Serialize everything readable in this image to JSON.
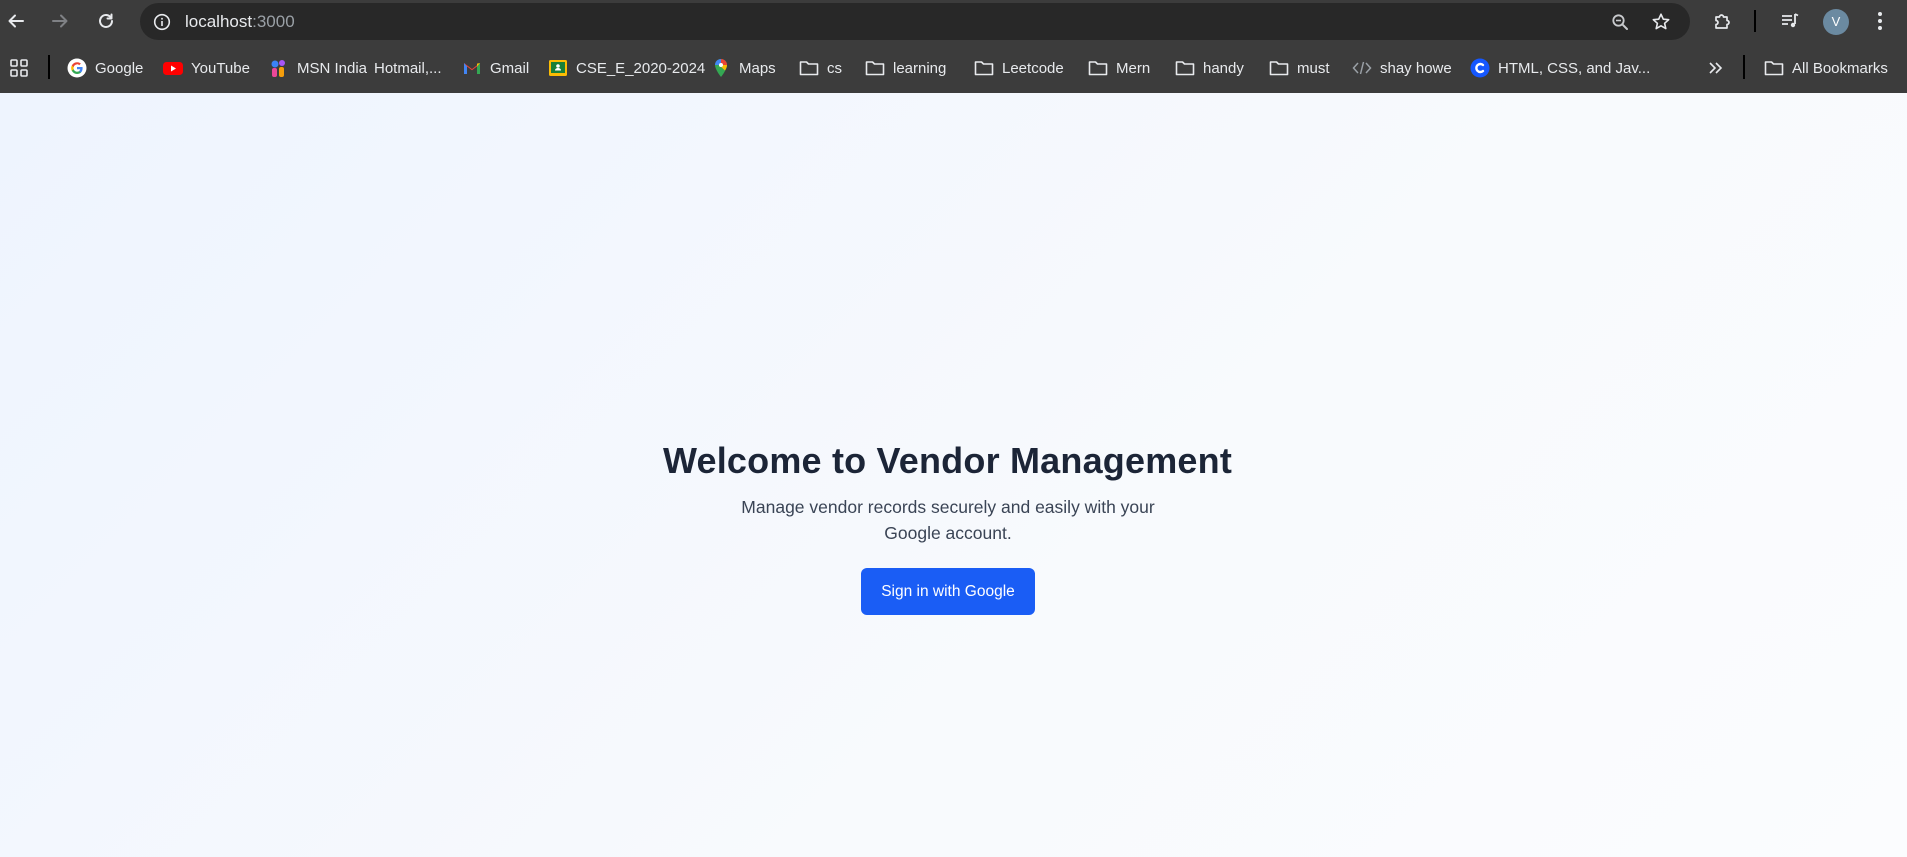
{
  "browser": {
    "url_host": "localhost",
    "url_port": ":3000",
    "profile_initial": "V",
    "icons": {
      "back": "back-arrow-icon",
      "forward": "forward-arrow-icon",
      "reload": "reload-icon",
      "site_info": "info-icon",
      "zoom": "zoom-icon",
      "bookmark": "star-icon",
      "extensions": "puzzle-icon",
      "media": "media-queue-icon",
      "menu": "kebab-menu-icon"
    }
  },
  "bookmarks": {
    "items": [
      {
        "label": "Google",
        "icon": "google-icon"
      },
      {
        "label": "YouTube",
        "icon": "youtube-icon"
      },
      {
        "label": "MSN India",
        "icon": "msn-icon"
      },
      {
        "label": "Hotmail,...",
        "icon": "none"
      },
      {
        "label": "Gmail",
        "icon": "gmail-icon"
      },
      {
        "label": "CSE_E_2020-2024",
        "icon": "classroom-icon"
      },
      {
        "label": "Maps",
        "icon": "maps-pin-icon"
      },
      {
        "label": "cs",
        "icon": "folder-icon"
      },
      {
        "label": "learning",
        "icon": "folder-icon"
      },
      {
        "label": "Leetcode",
        "icon": "folder-icon"
      },
      {
        "label": "Mern",
        "icon": "folder-icon"
      },
      {
        "label": "handy",
        "icon": "folder-icon"
      },
      {
        "label": "must",
        "icon": "folder-icon"
      },
      {
        "label": "shay howe",
        "icon": "code-icon"
      },
      {
        "label": "HTML, CSS, and Jav...",
        "icon": "codecademy-icon"
      }
    ],
    "all_bookmarks_label": "All Bookmarks"
  },
  "main": {
    "title": "Welcome to Vendor Management",
    "subtitle": "Manage vendor records securely and easily with your Google account.",
    "signin_label": "Sign in with Google"
  },
  "colors": {
    "chrome_bg": "#3c3c3c",
    "page_bg": "#f6f9fd",
    "heading": "#1c2537",
    "primary_button": "#1a5df5"
  }
}
